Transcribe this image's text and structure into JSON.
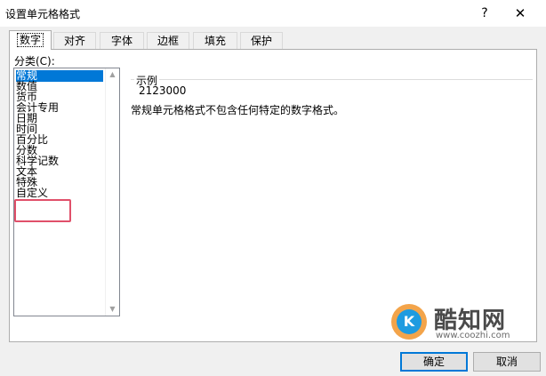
{
  "window": {
    "title": "设置单元格格式",
    "help_glyph": "?",
    "close_glyph": "✕"
  },
  "tabs": [
    {
      "label": "数字",
      "active": true
    },
    {
      "label": "对齐",
      "active": false
    },
    {
      "label": "字体",
      "active": false
    },
    {
      "label": "边框",
      "active": false
    },
    {
      "label": "填充",
      "active": false
    },
    {
      "label": "保护",
      "active": false
    }
  ],
  "category": {
    "label": "分类(C):",
    "items": [
      "常规",
      "数值",
      "货币",
      "会计专用",
      "日期",
      "时间",
      "百分比",
      "分数",
      "科学记数",
      "文本",
      "特殊",
      "自定义"
    ],
    "selected": "常规",
    "highlighted": "自定义"
  },
  "sample": {
    "label": "示例",
    "value": "2123000"
  },
  "description": "常规单元格格式不包含任何特定的数字格式。",
  "watermark": {
    "logo_letter": "K",
    "name": "酷知网",
    "url": "www.coozhi.com"
  },
  "buttons": {
    "ok": "确定",
    "cancel": "取消"
  },
  "colors": {
    "selection": "#0078d7",
    "highlight_box": "#e0506a"
  }
}
